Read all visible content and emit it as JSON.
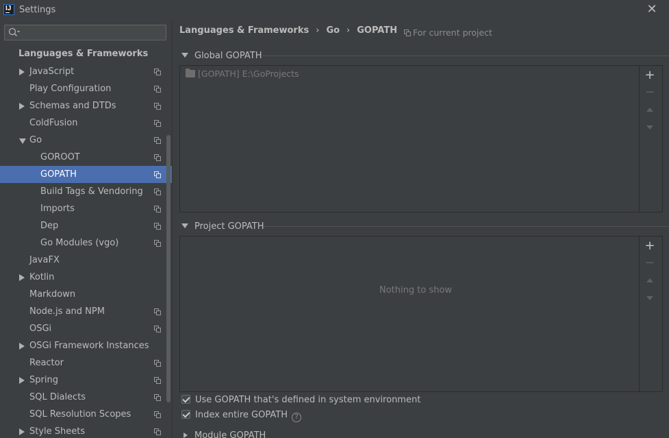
{
  "window": {
    "title": "Settings",
    "close": "✕"
  },
  "sidebar": {
    "section": "Languages & Frameworks",
    "items": [
      {
        "label": "JavaScript",
        "indent": 0,
        "arrow": "right",
        "proj": true
      },
      {
        "label": "Play Configuration",
        "indent": 0,
        "arrow": "none",
        "proj": true
      },
      {
        "label": "Schemas and DTDs",
        "indent": 0,
        "arrow": "right",
        "proj": true
      },
      {
        "label": "ColdFusion",
        "indent": 0,
        "arrow": "none",
        "proj": true
      },
      {
        "label": "Go",
        "indent": 0,
        "arrow": "down",
        "proj": true
      },
      {
        "label": "GOROOT",
        "indent": 1,
        "arrow": "none",
        "proj": true
      },
      {
        "label": "GOPATH",
        "indent": 1,
        "arrow": "none",
        "proj": true,
        "selected": true
      },
      {
        "label": "Build Tags & Vendoring",
        "indent": 1,
        "arrow": "none",
        "proj": true
      },
      {
        "label": "Imports",
        "indent": 1,
        "arrow": "none",
        "proj": true
      },
      {
        "label": "Dep",
        "indent": 1,
        "arrow": "none",
        "proj": true
      },
      {
        "label": "Go Modules (vgo)",
        "indent": 1,
        "arrow": "none",
        "proj": true
      },
      {
        "label": "JavaFX",
        "indent": 0,
        "arrow": "none",
        "proj": false
      },
      {
        "label": "Kotlin",
        "indent": 0,
        "arrow": "right",
        "proj": false
      },
      {
        "label": "Markdown",
        "indent": 0,
        "arrow": "none",
        "proj": false
      },
      {
        "label": "Node.js and NPM",
        "indent": 0,
        "arrow": "none",
        "proj": true
      },
      {
        "label": "OSGi",
        "indent": 0,
        "arrow": "none",
        "proj": true
      },
      {
        "label": "OSGi Framework Instances",
        "indent": 0,
        "arrow": "right",
        "proj": false
      },
      {
        "label": "Reactor",
        "indent": 0,
        "arrow": "none",
        "proj": true
      },
      {
        "label": "Spring",
        "indent": 0,
        "arrow": "right",
        "proj": true
      },
      {
        "label": "SQL Dialects",
        "indent": 0,
        "arrow": "none",
        "proj": true
      },
      {
        "label": "SQL Resolution Scopes",
        "indent": 0,
        "arrow": "none",
        "proj": true
      },
      {
        "label": "Style Sheets",
        "indent": 0,
        "arrow": "right",
        "proj": true
      }
    ]
  },
  "breadcrumb": {
    "a": "Languages & Frameworks",
    "b": "Go",
    "c": "GOPATH",
    "sep": "›"
  },
  "for_project": "For current project",
  "global_gopath": {
    "title": "Global GOPATH",
    "entries": [
      "[GOPATH] E:\\GoProjects"
    ]
  },
  "project_gopath": {
    "title": "Project GOPATH",
    "empty": "Nothing to show"
  },
  "toolbar": {
    "add": "+",
    "remove": "−"
  },
  "options": {
    "use_system": "Use GOPATH that's defined in system environment",
    "index_entire": "Index entire GOPATH",
    "help": "?"
  },
  "module_gopath": {
    "title": "Module GOPATH"
  }
}
